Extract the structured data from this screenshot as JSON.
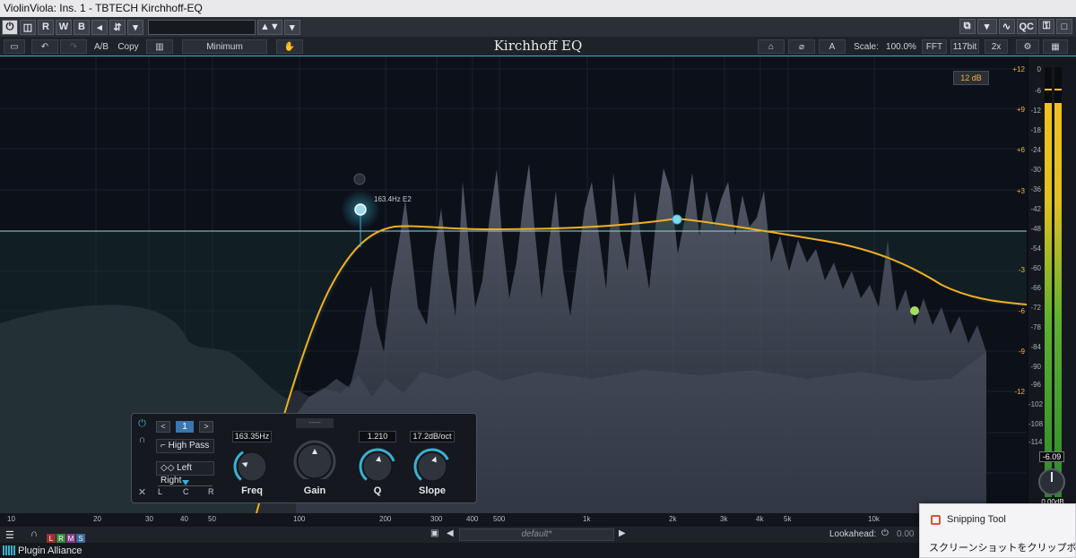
{
  "window": {
    "title": "ViolinViola: Ins. 1 - TBTECH Kirchhoff-EQ"
  },
  "host_toolbar": {
    "power": "⏻",
    "compare": "◫",
    "read": "R",
    "write": "W",
    "bypass": "B",
    "prev": "◂",
    "sidechain": "⇵",
    "dropdown": "▾",
    "qc": "QC"
  },
  "plugin_toolbar": {
    "undo": "↶",
    "redo": "↷",
    "ab": "A/B",
    "copy": "Copy",
    "piano": "▥",
    "mode": "Minimum",
    "hand": "✋",
    "title": "Kirchhoff EQ",
    "phase_icon": "⌀",
    "a_button": "A",
    "scale_label": "Scale:",
    "scale_value": "100.0%",
    "fft": "FFT",
    "bitdepth": "117bit",
    "oversample": "2x"
  },
  "display": {
    "db_range": "12 dB",
    "node_tooltip": "163.4Hz E2"
  },
  "gain_scale": [
    "+12",
    "+9",
    "+6",
    "+3",
    "-3",
    "-6",
    "-9",
    "-12"
  ],
  "meter_scale": [
    "0",
    "-6",
    "-12",
    "-18",
    "-24",
    "-30",
    "-36",
    "-42",
    "-48",
    "-54",
    "-60",
    "-66",
    "-72",
    "-78",
    "-84",
    "-90",
    "-96",
    "-102",
    "-108",
    "-114"
  ],
  "meter_readout": "-6.09",
  "output_readout": "0.00dB",
  "band_panel": {
    "band_number": "1",
    "filter_type": "High Pass",
    "stereo_mode": "Left Right",
    "pan_labels": [
      "L",
      "C",
      "R"
    ],
    "dots": "-----",
    "knobs": [
      {
        "label": "Freq",
        "value": "163.35Hz"
      },
      {
        "label": "Gain",
        "value": ""
      },
      {
        "label": "Q",
        "value": "1.210"
      },
      {
        "label": "Slope",
        "value": "17.2dB/oct"
      }
    ]
  },
  "freq_ruler": [
    "10",
    "20",
    "30",
    "40",
    "50",
    "100",
    "200",
    "300",
    "400",
    "500",
    "1k",
    "2k",
    "3k",
    "4k",
    "5k",
    "10k"
  ],
  "bottom": {
    "lrms": [
      "L",
      "R",
      "M",
      "S"
    ],
    "preset": "default*",
    "lookahead": "Lookahead:",
    "lookahead_value": "0.00"
  },
  "footer": {
    "brand": "Plugin Alliance"
  },
  "toast": {
    "title": "Snipping Tool",
    "text": "スクリーンショットをクリップボードにコピ"
  },
  "colors": {
    "accent": "#3ab0d0",
    "curve": "#f0b020",
    "gain_label": "#f0b33a"
  }
}
